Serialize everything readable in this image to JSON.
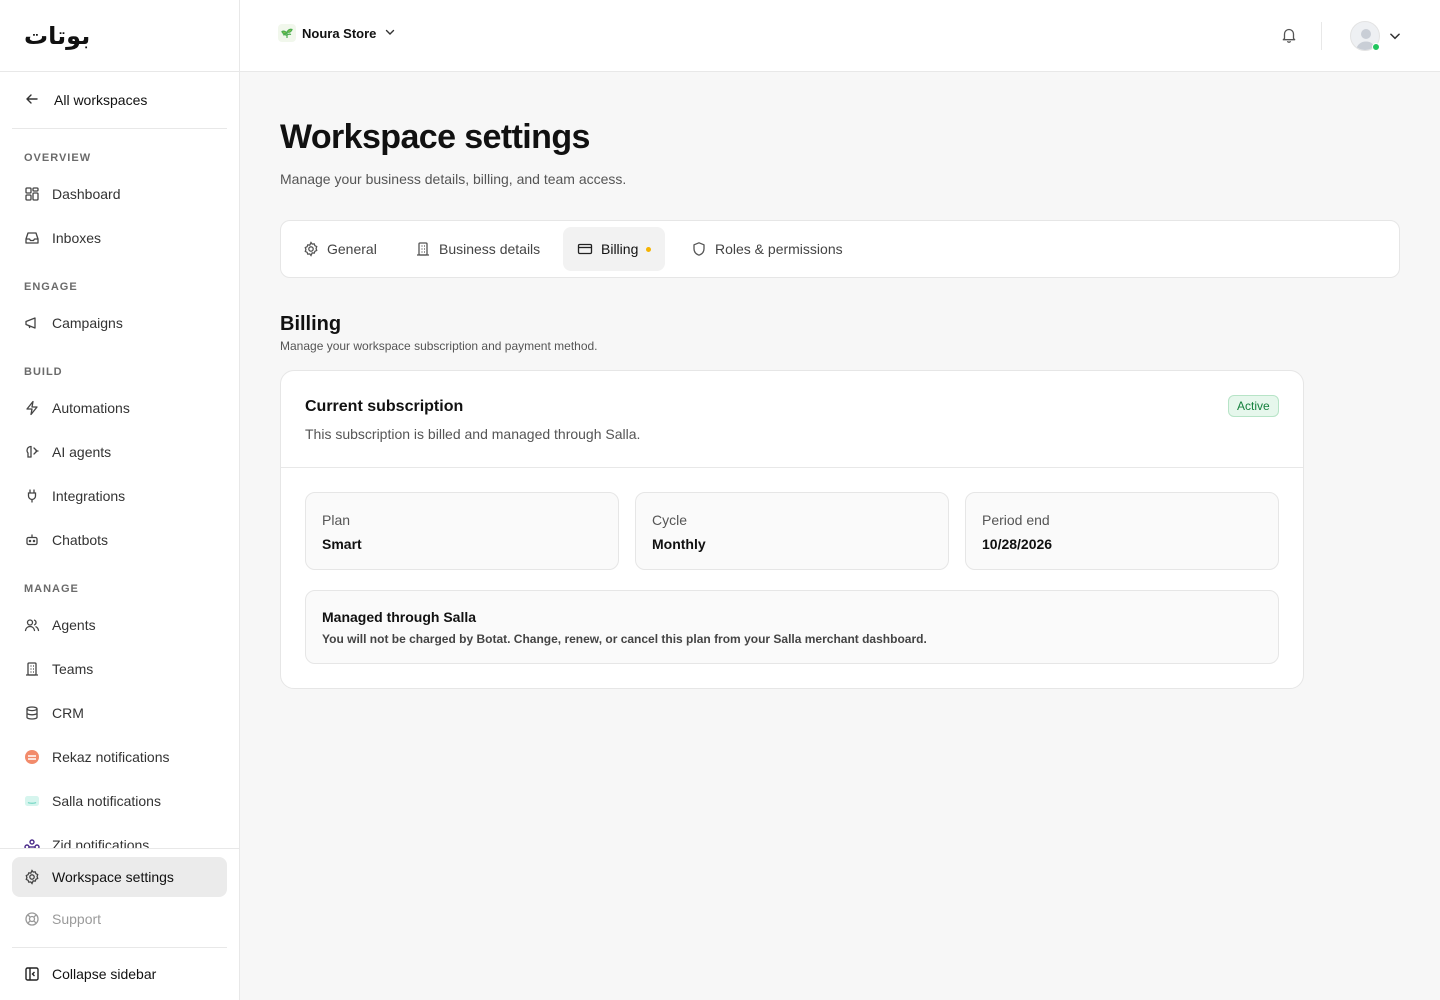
{
  "brand": {
    "logo_text": "بوتات"
  },
  "sidebar": {
    "back_label": "All workspaces",
    "sections": {
      "overview": "OVERVIEW",
      "engage": "ENGAGE",
      "build": "BUILD",
      "manage": "MANAGE"
    },
    "items": {
      "dashboard": "Dashboard",
      "inboxes": "Inboxes",
      "campaigns": "Campaigns",
      "automations": "Automations",
      "ai_agents": "AI agents",
      "integrations": "Integrations",
      "chatbots": "Chatbots",
      "agents": "Agents",
      "teams": "Teams",
      "crm": "CRM",
      "rekaz": "Rekaz notifications",
      "salla": "Salla notifications",
      "zid": "Zid notifications",
      "workspace_settings": "Workspace settings",
      "support": "Support",
      "collapse": "Collapse sidebar"
    },
    "active_item": "workspace_settings"
  },
  "topbar": {
    "store_name": "Noura Store",
    "status_color": "#22c55e"
  },
  "page": {
    "title": "Workspace settings",
    "subtitle": "Manage your business details, billing, and team access."
  },
  "tabs": [
    {
      "label": "General",
      "icon": "gear-icon"
    },
    {
      "label": "Business details",
      "icon": "building-icon"
    },
    {
      "label": "Billing",
      "icon": "credit-card-icon",
      "active": true
    },
    {
      "label": "Roles & permissions",
      "icon": "shield-icon"
    }
  ],
  "billing": {
    "title": "Billing",
    "subtitle": "Manage your workspace subscription and payment method.",
    "subscription": {
      "title": "Current subscription",
      "description": "This subscription is billed and managed through Salla.",
      "status": "Active",
      "plan_label": "Plan",
      "plan_value": "Smart",
      "cycle_label": "Cycle",
      "cycle_value": "Monthly",
      "period_label": "Period end",
      "period_value": "10/28/2026"
    },
    "notice": {
      "title": "Managed through Salla",
      "text": "You will not be charged by Botat. Change, renew, or cancel this plan from your Salla merchant dashboard."
    }
  },
  "colors": {
    "accent_active_bg": "#ebebeb",
    "badge_green": "#15803d",
    "billing_dot": "#f5b301"
  }
}
